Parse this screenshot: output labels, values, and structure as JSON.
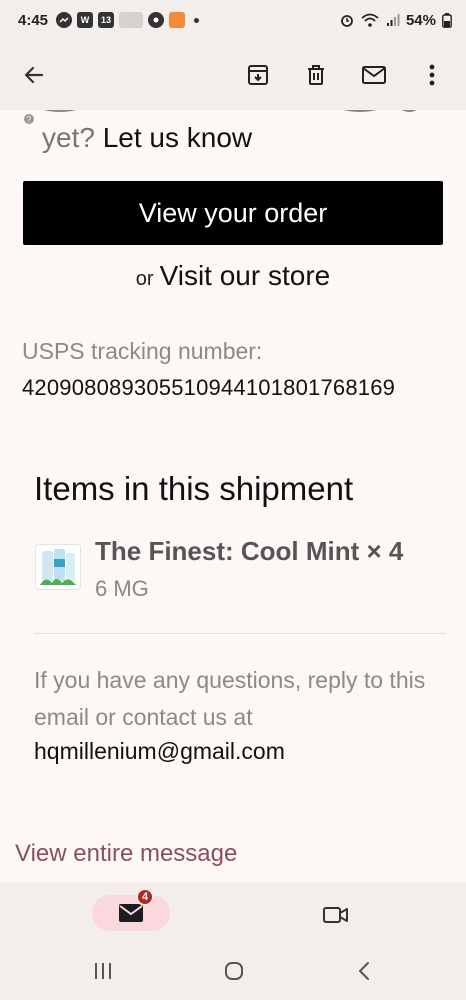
{
  "status_bar": {
    "time": "4:45",
    "battery": "54%",
    "notif_icons": [
      "messenger-icon",
      "w-icon",
      "calendar-13-icon",
      "bodyweight-icon",
      "target-icon",
      "orange-app-icon"
    ],
    "calendar_num": "13",
    "w_label": "W"
  },
  "app_bar": {
    "icons": [
      "back-arrow-icon",
      "archive-icon",
      "delete-icon",
      "mark-unread-icon",
      "more-vert-icon"
    ]
  },
  "email": {
    "help_prefix": "yet?",
    "help_link": "Let us know",
    "view_order_label": "View your order",
    "or_text": "or",
    "visit_store_label": "Visit our store",
    "tracking_label": "USPS tracking number:",
    "tracking_number": "420908089305510944101801768169",
    "items_heading": "Items in this shipment",
    "product_name": "The Finest: Cool Mint × 4",
    "product_variant": "6 MG",
    "questions_text": "If you have any questions, reply to this email or contact us at",
    "contact_email": "hqmillenium@gmail.com",
    "view_entire_label": "View entire message"
  },
  "bottom_nav": {
    "mail_badge": "4"
  },
  "colors": {
    "background": "#fdf8f6",
    "bar": "#f3eeec",
    "link_maroon": "#8a4f5e",
    "mail_pill": "#fbd8dd",
    "badge": "#b3261e"
  }
}
